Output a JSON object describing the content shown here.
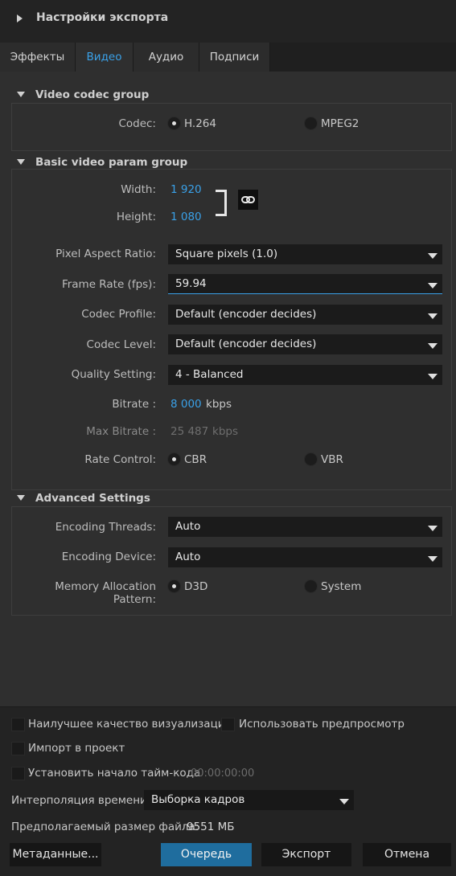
{
  "header": {
    "title": "Настройки экспорта",
    "icon": "triangle-right-icon"
  },
  "tabs": [
    {
      "label": "Эффекты",
      "active": false
    },
    {
      "label": "Видео",
      "active": true
    },
    {
      "label": "Аудио",
      "active": false
    },
    {
      "label": "Подписи",
      "active": false
    }
  ],
  "video_codec_group": {
    "title": "Video codec group",
    "codec_label": "Codec:",
    "options": [
      {
        "label": "H.264",
        "selected": true
      },
      {
        "label": "MPEG2",
        "selected": false
      }
    ]
  },
  "basic_video_group": {
    "title": "Basic video param group",
    "width_label": "Width:",
    "width_value": "1 920",
    "height_label": "Height:",
    "height_value": "1 080",
    "link_icon": "chain-link-icon",
    "pixel_aspect_label": "Pixel Aspect Ratio:",
    "pixel_aspect_value": "Square pixels (1.0)",
    "frame_rate_label": "Frame Rate (fps):",
    "frame_rate_value": "59.94",
    "codec_profile_label": "Codec Profile:",
    "codec_profile_value": "Default (encoder decides)",
    "codec_level_label": "Codec Level:",
    "codec_level_value": "Default (encoder decides)",
    "quality_label": "Quality Setting:",
    "quality_value": "4 - Balanced",
    "bitrate_label": "Bitrate :",
    "bitrate_value": "8 000",
    "bitrate_unit": "kbps",
    "max_bitrate_label": "Max Bitrate :",
    "max_bitrate_value": "25 487",
    "max_bitrate_unit": "kbps",
    "rate_control_label": "Rate Control:",
    "rate_control_options": [
      {
        "label": "CBR",
        "selected": true
      },
      {
        "label": "VBR",
        "selected": false
      }
    ]
  },
  "advanced_group": {
    "title": "Advanced Settings",
    "threads_label": "Encoding Threads:",
    "threads_value": "Auto",
    "device_label": "Encoding Device:",
    "device_value": "Auto",
    "memory_label": "Memory Allocation Pattern:",
    "memory_options": [
      {
        "label": "D3D",
        "selected": true
      },
      {
        "label": "System",
        "selected": false
      }
    ]
  },
  "bottom": {
    "best_quality_label": "Наилучшее качество визуализации",
    "use_preview_label": "Использовать предпросмотр",
    "import_label": "Импорт в проект",
    "timecode_label": "Установить начало тайм-кода",
    "timecode_value": "00:00:00:00",
    "interpolation_label": "Интерполяция времени:",
    "interpolation_value": "Выборка кадров",
    "filesize_label": "Предполагаемый размер файла:",
    "filesize_value": "9551 МБ"
  },
  "buttons": {
    "metadata": "Метаданные...",
    "queue": "Очередь",
    "export": "Экспорт",
    "cancel": "Отмена"
  },
  "colors": {
    "accent": "#3aa1e8",
    "primary_button": "#1f6d9e",
    "panel": "#2f2f2f",
    "background": "#232323"
  }
}
